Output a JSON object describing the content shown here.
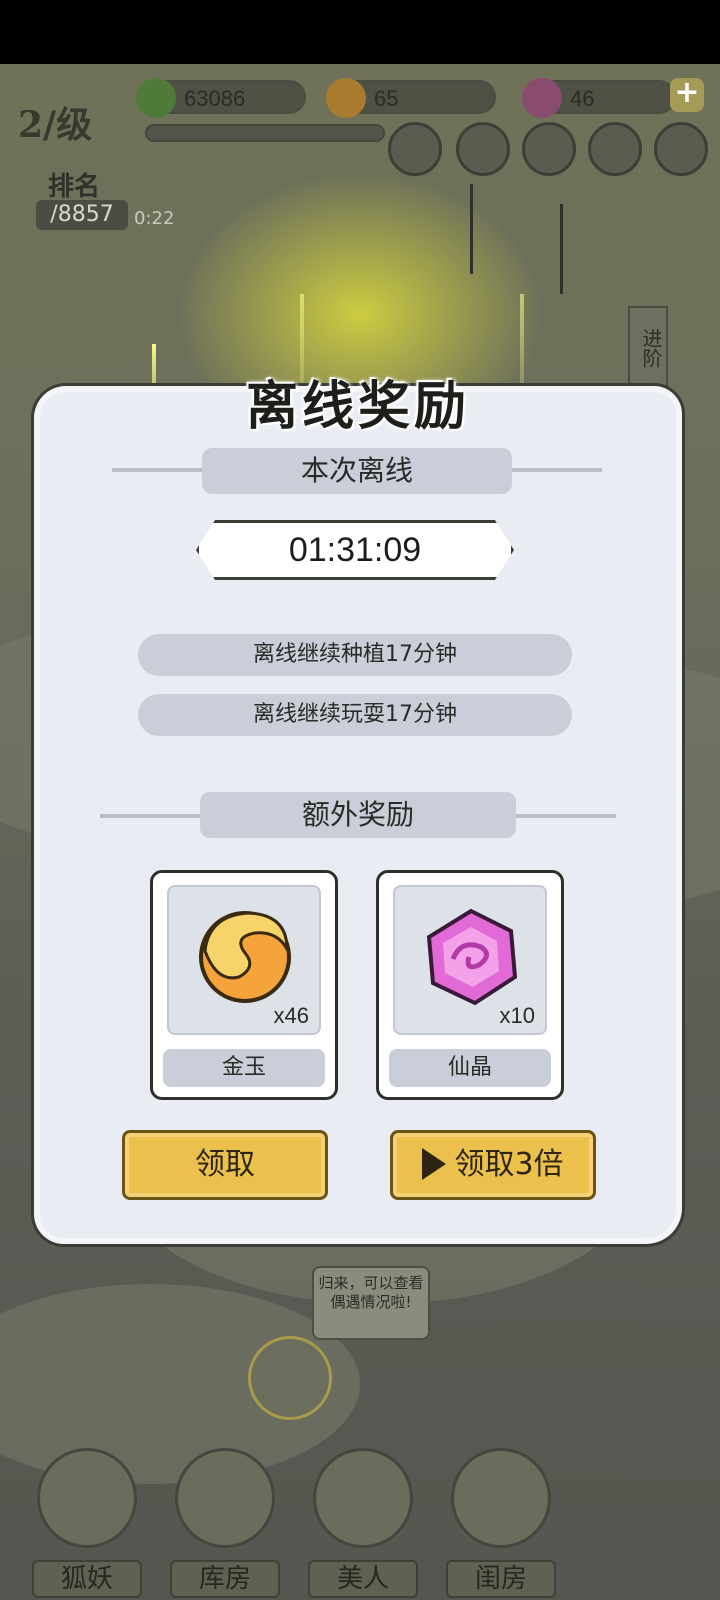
{
  "hud": {
    "resource_1": "63086",
    "resource_2": "65",
    "resource_3": "46",
    "level": "2/级",
    "rank_label": "排名",
    "rank_value": "/8857",
    "rank_sub": "0:22",
    "side_tab": "进阶"
  },
  "modal": {
    "title": "离线奖励",
    "section_offline": "本次离线",
    "timer": "01:31:09",
    "info_1": "离线继续种植17分钟",
    "info_2": "离线继续玩耍17分钟",
    "section_extra": "额外奖励",
    "rewards": [
      {
        "name": "金玉",
        "qty": "x46"
      },
      {
        "name": "仙晶",
        "qty": "x10"
      }
    ],
    "claim_label": "领取",
    "claim3x_label": "领取3倍"
  },
  "bubble_text": "归来，可以查看偶遇情况啦!",
  "bottom_nav": [
    "狐妖",
    "库房",
    "美人",
    "闺房"
  ],
  "colors": {
    "button": "#ecc04d",
    "paper": "#e9edf3",
    "glow": "#f0f060"
  }
}
